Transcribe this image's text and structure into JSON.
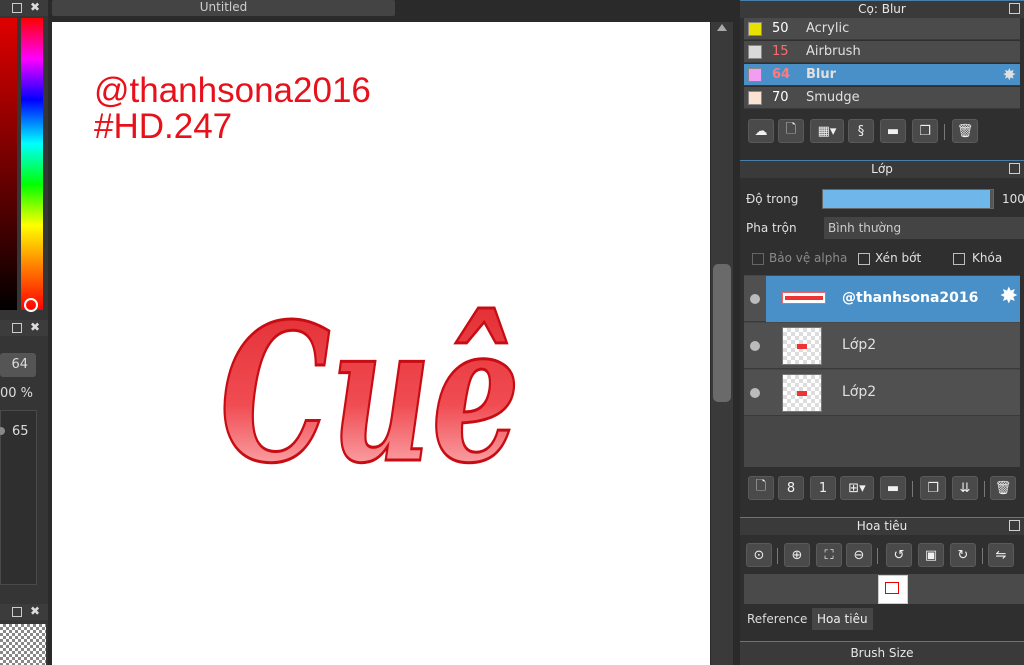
{
  "left_panel": {
    "size_value": "64",
    "opacity_value": "00 %",
    "slider_value": "65"
  },
  "canvas": {
    "tab_title": "Untitled",
    "watermark_line1": "@thanhsona2016",
    "watermark_line2": "#HD.247",
    "art_text": "Cuê",
    "colors": {
      "text": "#e8101a",
      "art_top": "#e53a3f",
      "art_bottom": "#ffd3d6"
    }
  },
  "brush_panel": {
    "title": "Cọ: Blur",
    "items": [
      {
        "size": "50",
        "name": "Acrylic",
        "swatch": "#e8e000",
        "active": false,
        "num_color": "#ffffff"
      },
      {
        "size": "15",
        "name": "Airbrush",
        "swatch": "#d9d9d9",
        "active": false,
        "num_color": "#ff6b6b"
      },
      {
        "size": "64",
        "name": "Blur",
        "swatch": "#f29cf2",
        "active": true,
        "num_color": "#ff7b7b"
      },
      {
        "size": "70",
        "name": "Smudge",
        "swatch": "#fbe3d3",
        "active": false,
        "num_color": "#ffffff"
      }
    ]
  },
  "layer_panel": {
    "title": "Lớp",
    "opacity_label": "Độ trong",
    "opacity_value": "100",
    "opacity_fraction": 0.98,
    "blend_label": "Pha trộn",
    "blend_value": "Bình thường",
    "protect_alpha": "Bảo vệ alpha",
    "clipping": "Xén bớt",
    "lock": "Khóa",
    "layers": [
      {
        "name": "@thanhsona2016",
        "active": true
      },
      {
        "name": "Lớp2",
        "active": false
      },
      {
        "name": "Lớp2",
        "active": false
      }
    ]
  },
  "navigator": {
    "title": "Hoa tiêu",
    "tabs": [
      "Reference",
      "Hoa tiêu"
    ]
  },
  "brush_size": {
    "title": "Brush Size"
  },
  "accent": "#4a90c8"
}
